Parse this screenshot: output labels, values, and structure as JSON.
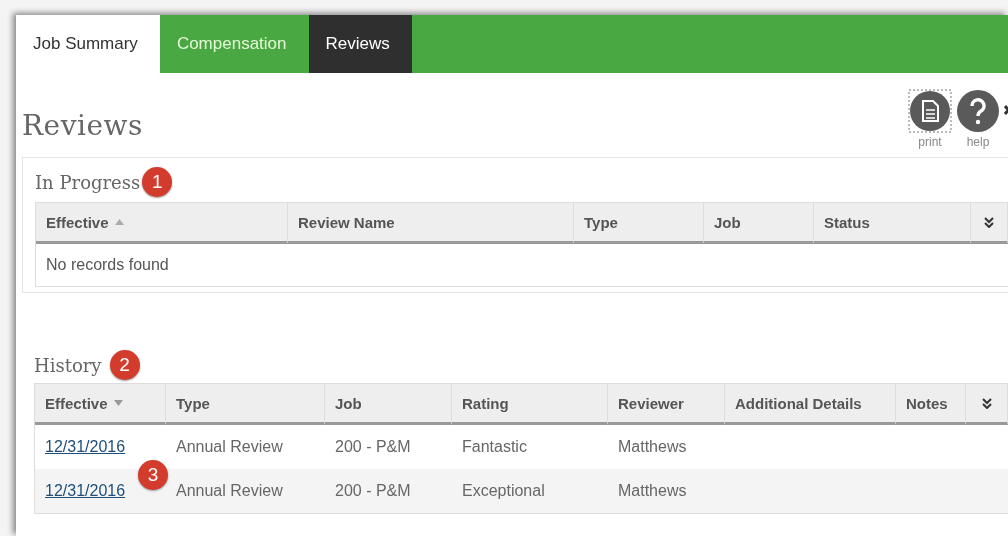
{
  "tabs": [
    {
      "label": "Job Summary",
      "kind": "plain",
      "selected": false
    },
    {
      "label": "Compensation",
      "kind": "nav",
      "selected": false
    },
    {
      "label": "Reviews",
      "kind": "nav",
      "selected": true
    }
  ],
  "page_title": "Reviews",
  "tools": [
    {
      "kind": "print",
      "label": "print"
    },
    {
      "kind": "help",
      "label": "help"
    }
  ],
  "in_progress": {
    "title": "In Progress",
    "badge": "1",
    "columns": [
      {
        "label": "Effective",
        "ascending": true
      },
      {
        "label": "Review Name"
      },
      {
        "label": "Type"
      },
      {
        "label": "Job"
      },
      {
        "label": "Status"
      }
    ],
    "empty_message": "No records found"
  },
  "history": {
    "title": "History",
    "badge": "2",
    "columns": [
      {
        "label": "Effective",
        "ascending": false
      },
      {
        "label": "Type"
      },
      {
        "label": "Job"
      },
      {
        "label": "Rating"
      },
      {
        "label": "Reviewer"
      },
      {
        "label": "Additional Details"
      },
      {
        "label": "Notes"
      }
    ],
    "rows": [
      {
        "effective": "12/31/2016",
        "type": "Annual Review",
        "job": "200 - P&M",
        "rating": "Fantastic",
        "reviewer": "Matthews"
      },
      {
        "effective": "12/31/2016",
        "type": "Annual Review",
        "job": "200 - P&M",
        "rating": "Exceptional",
        "reviewer": "Matthews"
      }
    ],
    "row_badge": "3"
  }
}
